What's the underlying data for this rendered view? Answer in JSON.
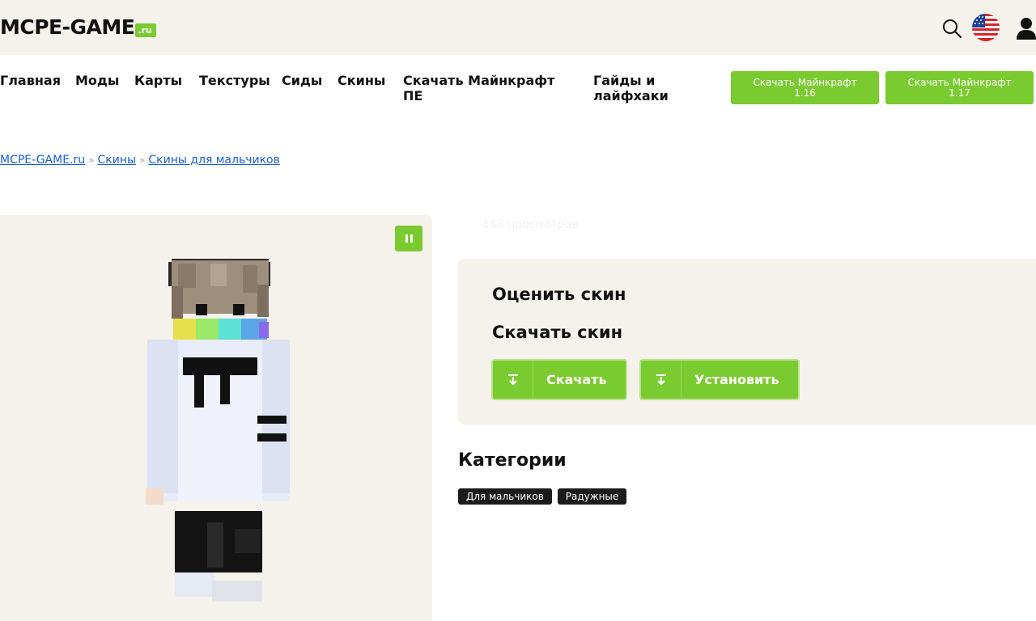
{
  "header": {
    "logo_text": "MCPE-GAME",
    "logo_badge": ".ru",
    "icons": [
      "search-icon",
      "us-flag-icon",
      "user-icon"
    ]
  },
  "nav": {
    "items": [
      "Главная",
      "Моды",
      "Карты",
      "Текстуры",
      "Сиды",
      "Скины",
      "Скачать Майнкрафт ПЕ",
      "Гайды и лайфхаки"
    ],
    "buttons": [
      {
        "line1": "Скачать Майнкрафт",
        "line2": "1.16"
      },
      {
        "line1": "Скачать Майнкрафт",
        "line2": "1.17"
      }
    ]
  },
  "breadcrumb": {
    "items": [
      "MCPE-GAME.ru",
      "Скины",
      "Скины для мальчиков"
    ],
    "separator": "»"
  },
  "preview": {
    "pause_icon": "pause-icon"
  },
  "skin_info": {
    "views": "148 просмотров",
    "rate_title": "Оценить скин",
    "download_title": "Скачать скин",
    "download_button": "Скачать",
    "install_button": "Установить"
  },
  "categories": {
    "title": "Категории",
    "tags": [
      "Для мальчиков",
      "Радужные"
    ]
  },
  "colors": {
    "accent": "#7acb2f",
    "panel_bg": "#f5f2ec",
    "link": "#1a5fd6",
    "tag_bg": "#1c1c1c"
  }
}
